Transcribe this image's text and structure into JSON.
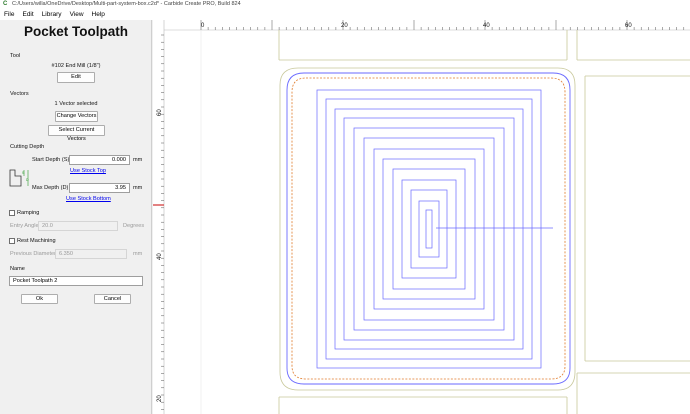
{
  "window": {
    "title": "C:/Users/willa/OneDrive/Desktop/Multi-part-system-box.c2d* - Carbide Create PRO, Build 824",
    "icon_name": "carbide-create-icon"
  },
  "menu": [
    "File",
    "Edit",
    "Library",
    "View",
    "Help"
  ],
  "panel": {
    "heading": "Pocket Toolpath",
    "tool": {
      "section_label": "Tool",
      "tool_name": "#102 End Mill (1/8\")",
      "edit_button": "Edit"
    },
    "vectors": {
      "section_label": "Vectors",
      "status": "1 Vector selected",
      "change_button": "Change Vectors",
      "select_button": "Select Current Vectors"
    },
    "cutting_depth": {
      "section_label": "Cutting Depth",
      "start_label": "Start Depth (S)",
      "start_value": "0.000",
      "start_unit": "mm",
      "use_stock_top": "Use Stock Top",
      "max_label": "Max Depth (D)",
      "max_value": "3.95",
      "max_unit": "mm",
      "use_stock_bottom": "Use Stock Bottom",
      "diagram_labels": [
        "S",
        "D"
      ]
    },
    "ramping": {
      "label": "Ramping",
      "checked": false,
      "angle_label": "Entry Angle",
      "angle_value": "20.0",
      "angle_unit": "Degrees"
    },
    "rest_machining": {
      "label": "Rest Machining",
      "checked": false,
      "diameter_label": "Previous Diameter",
      "diameter_value": "6.350",
      "diameter_unit": "mm"
    },
    "name": {
      "section_label": "Name",
      "value": "Pocket Toolpath 2"
    },
    "ok_button": "Ok",
    "cancel_button": "Cancel"
  },
  "canvas": {
    "ruler_top_labels": [
      "0",
      "20",
      "40",
      "60"
    ],
    "ruler_left_labels": [
      "60",
      "40",
      "20"
    ],
    "colors": {
      "toolpath": "#6a6aff",
      "boundary": "#a8a8e8",
      "stock_outline": "#c8c89a",
      "offset_line": "#e07a2a",
      "origin_marker": "#d03030"
    }
  }
}
